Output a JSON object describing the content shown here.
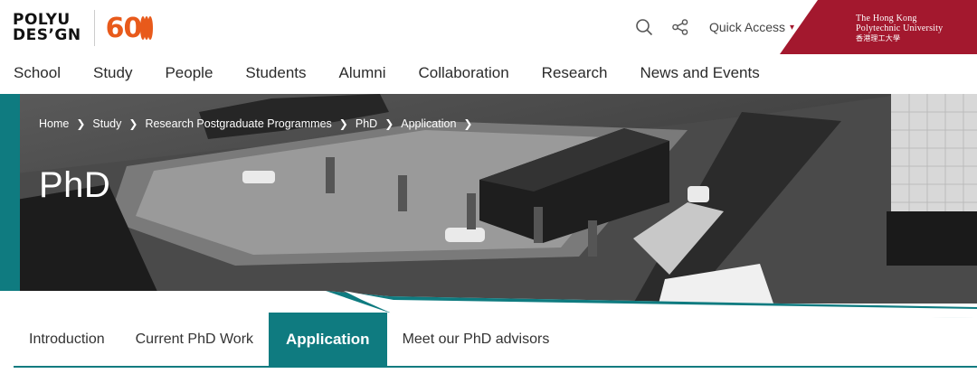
{
  "brand": {
    "logo_line1": "POLYU",
    "logo_line2": "DES’GN",
    "anniversary": "60",
    "university_en_line1": "The Hong Kong",
    "university_en_line2": "Polytechnic University",
    "university_cn": "香港理工大學",
    "accent_color": "#0f7b80",
    "brand_red": "#a3182e",
    "anniversary_color": "#e85a1b"
  },
  "tools": {
    "search_icon": "search-icon",
    "share_icon": "share-icon",
    "quick_access_label": "Quick Access"
  },
  "nav": {
    "items": [
      "School",
      "Study",
      "People",
      "Students",
      "Alumni",
      "Collaboration",
      "Research",
      "News and Events"
    ]
  },
  "breadcrumb": {
    "items": [
      "Home",
      "Study",
      "Research Postgraduate Programmes",
      "PhD",
      "Application"
    ]
  },
  "hero": {
    "title": "PhD"
  },
  "tabs": {
    "items": [
      "Introduction",
      "Current PhD Work",
      "Application",
      "Meet our PhD advisors"
    ],
    "active": "Application"
  }
}
